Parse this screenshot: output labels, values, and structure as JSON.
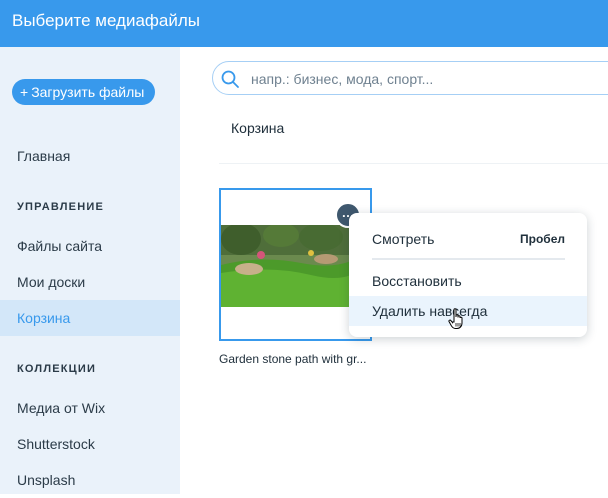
{
  "header": {
    "title": "Выберите медиафайлы"
  },
  "sidebar": {
    "upload_button": {
      "plus": "+",
      "label": "Загрузить файлы"
    },
    "home": "Главная",
    "manage_section": "УПРАВЛЕНИЕ",
    "manage_items": [
      "Файлы сайта",
      "Мои доски",
      "Корзина"
    ],
    "collections_section": "КОЛЛЕКЦИИ",
    "collection_items": [
      "Медиа от Wix",
      "Shutterstock",
      "Unsplash"
    ]
  },
  "search": {
    "placeholder": "напр.: бизнес, мода, спорт...",
    "value": ""
  },
  "breadcrumb": "Корзина",
  "file": {
    "caption": "Garden stone path with gr...",
    "more_icon": "…"
  },
  "context_menu": {
    "view": "Смотреть",
    "view_shortcut": "Пробел",
    "restore": "Восстановить",
    "delete_forever": "Удалить навсегда"
  },
  "colors": {
    "accent": "#3899ec",
    "sidebar_bg": "#eaf2fa",
    "active_bg": "#d3e7f9"
  }
}
